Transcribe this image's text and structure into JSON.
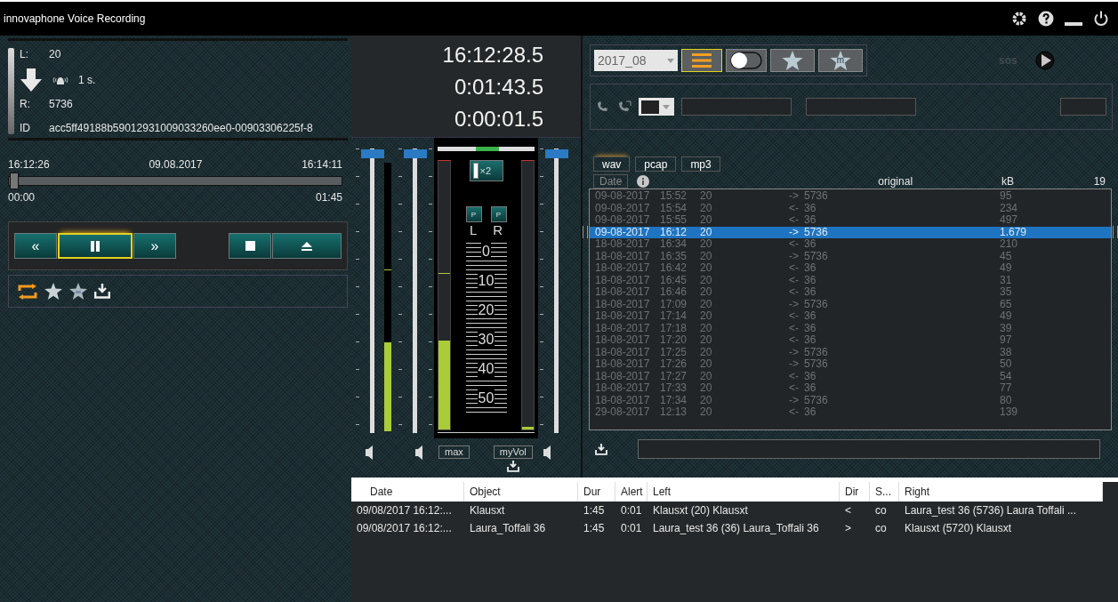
{
  "window": {
    "title": "innovaphone Voice Recording"
  },
  "call_info": {
    "left_label": "L:",
    "left_value": "20",
    "interval": "1 s.",
    "right_label": "R:",
    "right_value": "5736",
    "id_label": "ID",
    "id_value": "acc5ff49188b59012931009033260ee0-00903306225f-8"
  },
  "timeline": {
    "start": "16:12:26",
    "date": "09.08.2017",
    "end": "16:14:11",
    "elapsed": "00:00",
    "total": "01:45",
    "level": 0
  },
  "transport": [
    {
      "kind": "rewind",
      "label": "«",
      "selected": false
    },
    {
      "kind": "pause",
      "selected": true
    },
    {
      "kind": "forward",
      "label": "»",
      "selected": false
    },
    {
      "kind": "stop",
      "selected": false
    },
    {
      "kind": "eject",
      "selected": false
    }
  ],
  "clocks": [
    "16:12:28.5",
    "0:01:43.5",
    "0:00:01.5"
  ],
  "mixer": {
    "faders": [
      {
        "level": 0.98
      },
      {
        "level": 0.98
      },
      {
        "level": 0.98
      }
    ],
    "input_meter": {
      "level": 0.33,
      "peak": {
        "level": 0.6
      }
    },
    "balance": {
      "level": 0.5
    },
    "zoom_button": "×2",
    "p_buttons": [
      "P",
      "P"
    ],
    "channels": [
      "L",
      "R"
    ],
    "scale": [
      "0",
      "10",
      "20",
      "30",
      "40",
      "50"
    ],
    "left_meter": {
      "level": 0.33,
      "peak": {
        "level": 0.58
      }
    },
    "right_meter": {
      "level": 0.01
    },
    "max_button": "max",
    "myvol_button": "myVol"
  },
  "toolbar": {
    "period": "2017_08",
    "buttons": [
      {
        "kind": "list",
        "selected": true
      },
      {
        "kind": "toggle",
        "selected": false
      },
      {
        "kind": "star",
        "selected": false
      },
      {
        "kind": "star-m",
        "label": "m",
        "selected": false
      }
    ],
    "sos": "sos"
  },
  "formats": [
    {
      "label": "wav",
      "selected": true
    },
    {
      "label": "pcap",
      "selected": false
    },
    {
      "label": "mp3",
      "selected": false
    }
  ],
  "recordings": {
    "sort_button": "Date",
    "original": "original",
    "kb": "kB",
    "count": "19",
    "rows": [
      {
        "date": "09-08-2017",
        "time": "15:52",
        "number": "20",
        "dir": "->",
        "party": "5736",
        "kb": "95",
        "selected": false
      },
      {
        "date": "09-08-2017",
        "time": "15:54",
        "number": "20",
        "dir": "<-",
        "party": "36",
        "kb": "234",
        "selected": false
      },
      {
        "date": "09-08-2017",
        "time": "15:55",
        "number": "20",
        "dir": "<-",
        "party": "36",
        "kb": "497",
        "selected": false
      },
      {
        "date": "09-08-2017",
        "time": "16:12",
        "number": "20",
        "dir": "->",
        "party": "5736",
        "kb": "1.679",
        "selected": true
      },
      {
        "date": "18-08-2017",
        "time": "16:34",
        "number": "20",
        "dir": "<-",
        "party": "36",
        "kb": "210",
        "selected": false
      },
      {
        "date": "18-08-2017",
        "time": "16:35",
        "number": "20",
        "dir": "->",
        "party": "5736",
        "kb": "45",
        "selected": false
      },
      {
        "date": "18-08-2017",
        "time": "16:42",
        "number": "20",
        "dir": "<-",
        "party": "36",
        "kb": "49",
        "selected": false
      },
      {
        "date": "18-08-2017",
        "time": "16:45",
        "number": "20",
        "dir": "<-",
        "party": "36",
        "kb": "31",
        "selected": false
      },
      {
        "date": "18-08-2017",
        "time": "16:46",
        "number": "20",
        "dir": "<-",
        "party": "36",
        "kb": "35",
        "selected": false
      },
      {
        "date": "18-08-2017",
        "time": "17:09",
        "number": "20",
        "dir": "->",
        "party": "5736",
        "kb": "65",
        "selected": false
      },
      {
        "date": "18-08-2017",
        "time": "17:14",
        "number": "20",
        "dir": "<-",
        "party": "36",
        "kb": "49",
        "selected": false
      },
      {
        "date": "18-08-2017",
        "time": "17:18",
        "number": "20",
        "dir": "<-",
        "party": "36",
        "kb": "39",
        "selected": false
      },
      {
        "date": "18-08-2017",
        "time": "17:20",
        "number": "20",
        "dir": "<-",
        "party": "36",
        "kb": "97",
        "selected": false
      },
      {
        "date": "18-08-2017",
        "time": "17:25",
        "number": "20",
        "dir": "->",
        "party": "5736",
        "kb": "38",
        "selected": false
      },
      {
        "date": "18-08-2017",
        "time": "17:26",
        "number": "20",
        "dir": "->",
        "party": "5736",
        "kb": "50",
        "selected": false
      },
      {
        "date": "18-08-2017",
        "time": "17:27",
        "number": "20",
        "dir": "<-",
        "party": "36",
        "kb": "54",
        "selected": false
      },
      {
        "date": "18-08-2017",
        "time": "17:33",
        "number": "20",
        "dir": "<-",
        "party": "36",
        "kb": "77",
        "selected": false
      },
      {
        "date": "18-08-2017",
        "time": "17:34",
        "number": "20",
        "dir": "->",
        "party": "5736",
        "kb": "80",
        "selected": false
      },
      {
        "date": "29-08-2017",
        "time": "12:13",
        "number": "20",
        "dir": "<-",
        "party": "36",
        "kb": "139",
        "selected": false
      }
    ]
  },
  "calls": {
    "columns": [
      "Date",
      "Object",
      "Dur",
      "Alert",
      "Left",
      "Dir",
      "S...",
      "Right"
    ],
    "rows": [
      [
        "09/08/2017 16:12:...",
        "Klausxt",
        "1:45",
        "0:01",
        "Klausxt (20) Klausxt",
        "<",
        "co",
        "Laura_test 36 (5736) Laura Toffali ..."
      ],
      [
        "09/08/2017 16:12:...",
        "Laura_Toffali 36",
        "1:45",
        "0:01",
        "Laura_test 36 (36) Laura_Toffali 36",
        ">",
        "co",
        "Klausxt (5720) Klausxt"
      ]
    ]
  }
}
